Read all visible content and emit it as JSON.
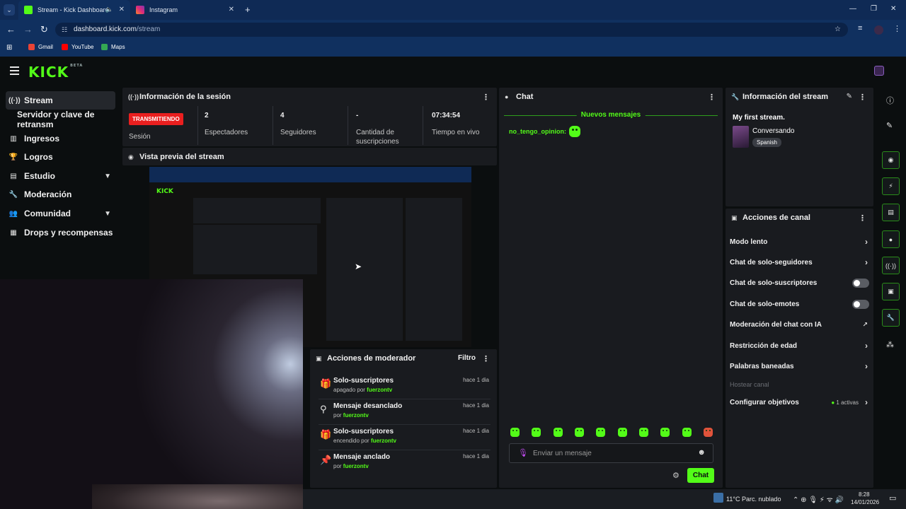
{
  "browser": {
    "tabs": [
      {
        "title": "Stream - Kick Dashboard",
        "active": true
      },
      {
        "title": "Instagram",
        "active": false
      }
    ],
    "url_host": "dashboard.kick.com",
    "url_path": "/stream",
    "bookmarks": [
      "Gmail",
      "YouTube",
      "Maps"
    ]
  },
  "brand": {
    "logo": "KICK",
    "badge": "BETA",
    "accent": "#53fc18"
  },
  "sidebar": {
    "items": [
      {
        "label": "Stream",
        "icon": "broadcast-icon",
        "active": true
      },
      {
        "label": "Servidor y clave de retransm",
        "icon": "",
        "active": false
      },
      {
        "label": "Ingresos",
        "icon": "chart-icon"
      },
      {
        "label": "Logros",
        "icon": "trophy-icon"
      },
      {
        "label": "Estudio",
        "icon": "studio-icon",
        "expandable": true
      },
      {
        "label": "Moderación",
        "icon": "wrench-icon"
      },
      {
        "label": "Comunidad",
        "icon": "community-icon",
        "expandable": true
      },
      {
        "label": "Drops y recompensas",
        "icon": "drops-icon"
      }
    ]
  },
  "session": {
    "title": "Información de la sesión",
    "badge": "TRANSMITIENDO",
    "stats": [
      {
        "value": "",
        "label": "Sesión"
      },
      {
        "value": "2",
        "label": "Espectadores"
      },
      {
        "value": "4",
        "label": "Seguidores"
      },
      {
        "value": "-",
        "label": "Cantidad de suscripciones"
      },
      {
        "value": "07:34:54",
        "label": "Tiempo en vivo"
      }
    ]
  },
  "preview": {
    "title": "Vista previa del stream"
  },
  "moderator": {
    "title": "Acciones de moderador",
    "filter": "Filtro",
    "rows": [
      {
        "title": "Solo-suscriptores",
        "detail": "apagado por",
        "user": "fuerzontv",
        "time": "hace 1 dia",
        "icon": "gift-icon"
      },
      {
        "title": "Mensaje desanclado",
        "detail": "por",
        "user": "fuerzontv",
        "time": "hace 1 dia",
        "icon": "unpin-icon"
      },
      {
        "title": "Solo-suscriptores",
        "detail": "encendido por",
        "user": "fuerzontv",
        "time": "hace 1 dia",
        "icon": "gift-icon"
      },
      {
        "title": "Mensaje anclado",
        "detail": "por",
        "user": "fuerzontv",
        "time": "hace 1 dia",
        "icon": "pin-icon"
      }
    ]
  },
  "chat": {
    "title": "Chat",
    "new_messages": "Nuevos mensajes",
    "messages": [
      {
        "user": "no_tengo_opinion:",
        "emote": "emote-icon"
      }
    ],
    "placeholder": "Enviar un mensaje",
    "send_label": "Chat"
  },
  "stream_info": {
    "title": "Información del stream",
    "stream_title": "My first stream.",
    "category": "Conversando",
    "language": "Spanish"
  },
  "channel_actions": {
    "title": "Acciones de canal",
    "rows": [
      {
        "label": "Modo lento",
        "control": "chevron"
      },
      {
        "label": "Chat de solo-seguidores",
        "control": "chevron"
      },
      {
        "label": "Chat de solo-suscriptores",
        "control": "toggle"
      },
      {
        "label": "Chat de solo-emotes",
        "control": "toggle"
      },
      {
        "label": "Moderación del chat con IA",
        "control": "external"
      },
      {
        "label": "Restricción de edad",
        "control": "chevron"
      },
      {
        "label": "Palabras baneadas",
        "control": "chevron"
      },
      {
        "label": "Hostear canal",
        "control": "disabled"
      },
      {
        "label": "Configurar objetivos",
        "control": "chevron",
        "status": "1 activas"
      }
    ]
  },
  "taskbar": {
    "weather": "11°C  Parc. nublado",
    "time": "8:28",
    "date": "14/01/2026"
  }
}
